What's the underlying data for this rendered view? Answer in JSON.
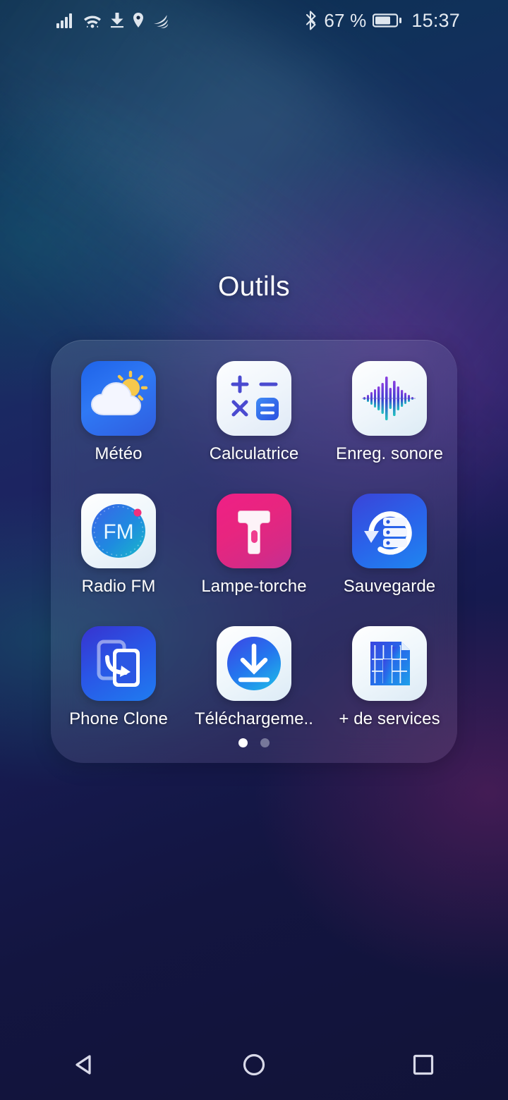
{
  "status_bar": {
    "left_icons": [
      "signal-bars-icon",
      "wifi-icon",
      "download-icon",
      "location-icon",
      "nfc-swoosh-icon"
    ],
    "bluetooth_icon": "bluetooth-icon",
    "battery_percent_text": "67 %",
    "battery_level": 67,
    "time": "15:37"
  },
  "folder": {
    "title": "Outils",
    "apps": [
      {
        "label": "Météo",
        "icon": "weather-icon"
      },
      {
        "label": "Calculatrice",
        "icon": "calculator-icon"
      },
      {
        "label": "Enreg. sonore",
        "icon": "sound-recorder-icon"
      },
      {
        "label": "Radio FM",
        "icon": "fm-radio-icon",
        "badge_text": "FM"
      },
      {
        "label": "Lampe-torche",
        "icon": "flashlight-icon"
      },
      {
        "label": "Sauvegarde",
        "icon": "backup-icon"
      },
      {
        "label": "Phone Clone",
        "icon": "phone-clone-icon"
      },
      {
        "label": "Téléchargeme..",
        "icon": "downloads-icon"
      },
      {
        "label": "+ de services",
        "icon": "more-services-icon"
      }
    ],
    "pages": {
      "count": 2,
      "active_index": 0
    }
  },
  "nav_bar": {
    "back_label": "back-triangle-icon",
    "home_label": "home-circle-icon",
    "recents_label": "recents-square-icon"
  },
  "colors": {
    "accent_blue": "#2f6ef0",
    "accent_cyan": "#1fb6e8",
    "accent_pink": "#e8297f",
    "panel_tint": "#b4d2e1",
    "text_white": "#ffffff",
    "status_text": "#e4eaf1"
  }
}
